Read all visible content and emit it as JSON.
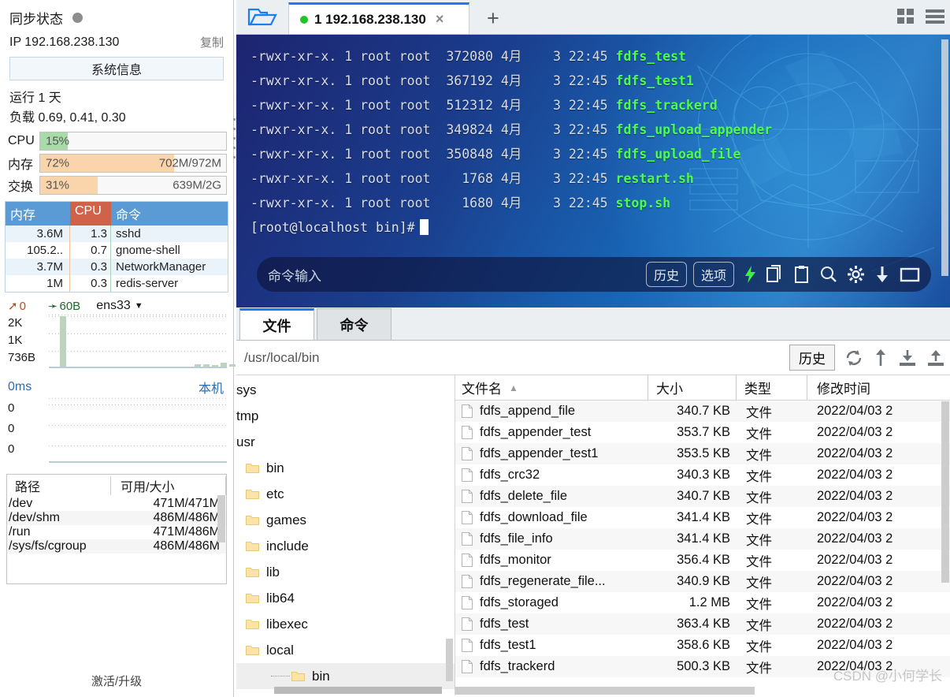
{
  "sidebar": {
    "sync_label": "同步状态",
    "sync_status_color": "#8d8d8d",
    "ip_text": "IP 192.168.238.130",
    "copy_label": "复制",
    "sysinfo_button": "系统信息",
    "uptime": "运行 1 天",
    "loadavg": "负载 0.69, 0.41, 0.30",
    "meters": [
      {
        "label": "CPU",
        "pct_text": "15%",
        "pct": 15,
        "value": "",
        "color": "#a9dba9"
      },
      {
        "label": "内存",
        "pct_text": "72%",
        "pct": 72,
        "value": "702M/972M",
        "color": "#fad4aa"
      },
      {
        "label": "交换",
        "pct_text": "31%",
        "pct": 31,
        "value": "639M/2G",
        "color": "#fad4aa"
      }
    ],
    "proc_headers": {
      "mem": "内存",
      "cpu": "CPU",
      "cmd": "命令"
    },
    "proc_header_bg": "#5b9bd5",
    "proc_cpu_bg": "#d0624a",
    "processes": [
      {
        "mem": "3.6M",
        "cpu": "1.3",
        "cmd": "sshd"
      },
      {
        "mem": "105.2..",
        "cpu": "0.7",
        "cmd": "gnome-shell"
      },
      {
        "mem": "3.7M",
        "cpu": "0.3",
        "cmd": "NetworkManager"
      },
      {
        "mem": "1M",
        "cpu": "0.3",
        "cmd": "redis-server"
      }
    ],
    "net": {
      "upload": "0",
      "download": "60B",
      "interface": "ens33",
      "y_labels": [
        "2K",
        "1K",
        "736B"
      ]
    },
    "latency": {
      "value": "0ms",
      "host": "本机",
      "y_labels": [
        "0",
        "0",
        "0"
      ]
    },
    "disk_headers": {
      "path": "路径",
      "size": "可用/大小"
    },
    "disks": [
      {
        "path": "/dev",
        "size": "471M/471M"
      },
      {
        "path": "/dev/shm",
        "size": "486M/486M"
      },
      {
        "path": "/run",
        "size": "471M/486M"
      },
      {
        "path": "/sys/fs/cgroup",
        "size": "486M/486M"
      }
    ],
    "activate_label": "激活/升级"
  },
  "terminal": {
    "tab": {
      "title": "1 192.168.238.130",
      "status_color": "#22c22a",
      "close": "×"
    },
    "add_tab": "+",
    "lines": [
      {
        "perm": "-rwxr-xr-x. 1 root root",
        "size": "372080",
        "date": "4月    3 22:45",
        "name": "fdfs_test"
      },
      {
        "perm": "-rwxr-xr-x. 1 root root",
        "size": "367192",
        "date": "4月    3 22:45",
        "name": "fdfs_test1"
      },
      {
        "perm": "-rwxr-xr-x. 1 root root",
        "size": "512312",
        "date": "4月    3 22:45",
        "name": "fdfs_trackerd"
      },
      {
        "perm": "-rwxr-xr-x. 1 root root",
        "size": "349824",
        "date": "4月    3 22:45",
        "name": "fdfs_upload_appender"
      },
      {
        "perm": "-rwxr-xr-x. 1 root root",
        "size": "350848",
        "date": "4月    3 22:45",
        "name": "fdfs_upload_file"
      },
      {
        "perm": "-rwxr-xr-x. 1 root root",
        "size": "1768",
        "date": "4月    3 22:45",
        "name": "restart.sh"
      },
      {
        "perm": "-rwxr-xr-x. 1 root root",
        "size": "1680",
        "date": "4月    3 22:45",
        "name": "stop.sh"
      }
    ],
    "prompt": "[root@localhost bin]#",
    "command_placeholder": "命令输入",
    "history_button": "历史",
    "options_button": "选项"
  },
  "file_panel": {
    "tabs": [
      {
        "label": "文件",
        "active": true
      },
      {
        "label": "命令",
        "active": false
      }
    ],
    "path": "/usr/local/bin",
    "history_button": "历史",
    "tree": [
      {
        "label": "sys",
        "depth": 0,
        "folder": false,
        "selected": false,
        "clipped": true
      },
      {
        "label": "tmp",
        "depth": 0,
        "folder": false,
        "selected": false,
        "clipped": true
      },
      {
        "label": "usr",
        "depth": 0,
        "folder": false,
        "selected": false,
        "clipped": true
      },
      {
        "label": "bin",
        "depth": 1,
        "folder": true,
        "selected": false
      },
      {
        "label": "etc",
        "depth": 1,
        "folder": true,
        "selected": false
      },
      {
        "label": "games",
        "depth": 1,
        "folder": true,
        "selected": false
      },
      {
        "label": "include",
        "depth": 1,
        "folder": true,
        "selected": false
      },
      {
        "label": "lib",
        "depth": 1,
        "folder": true,
        "selected": false
      },
      {
        "label": "lib64",
        "depth": 1,
        "folder": true,
        "selected": false
      },
      {
        "label": "libexec",
        "depth": 1,
        "folder": true,
        "selected": false
      },
      {
        "label": "local",
        "depth": 1,
        "folder": true,
        "selected": false
      },
      {
        "label": "bin",
        "depth": 2,
        "folder": true,
        "selected": true
      }
    ],
    "columns": {
      "name": "文件名",
      "size": "大小",
      "type": "类型",
      "time": "修改时间"
    },
    "sort_indicator": "▲",
    "files": [
      {
        "name": "fdfs_append_file",
        "size": "340.7 KB",
        "type": "文件",
        "time": "2022/04/03 2"
      },
      {
        "name": "fdfs_appender_test",
        "size": "353.7 KB",
        "type": "文件",
        "time": "2022/04/03 2"
      },
      {
        "name": "fdfs_appender_test1",
        "size": "353.5 KB",
        "type": "文件",
        "time": "2022/04/03 2"
      },
      {
        "name": "fdfs_crc32",
        "size": "340.3 KB",
        "type": "文件",
        "time": "2022/04/03 2"
      },
      {
        "name": "fdfs_delete_file",
        "size": "340.7 KB",
        "type": "文件",
        "time": "2022/04/03 2"
      },
      {
        "name": "fdfs_download_file",
        "size": "341.4 KB",
        "type": "文件",
        "time": "2022/04/03 2"
      },
      {
        "name": "fdfs_file_info",
        "size": "341.4 KB",
        "type": "文件",
        "time": "2022/04/03 2"
      },
      {
        "name": "fdfs_monitor",
        "size": "356.4 KB",
        "type": "文件",
        "time": "2022/04/03 2"
      },
      {
        "name": "fdfs_regenerate_file...",
        "size": "340.9 KB",
        "type": "文件",
        "time": "2022/04/03 2"
      },
      {
        "name": "fdfs_storaged",
        "size": "1.2 MB",
        "type": "文件",
        "time": "2022/04/03 2"
      },
      {
        "name": "fdfs_test",
        "size": "363.4 KB",
        "type": "文件",
        "time": "2022/04/03 2"
      },
      {
        "name": "fdfs_test1",
        "size": "358.6 KB",
        "type": "文件",
        "time": "2022/04/03 2"
      },
      {
        "name": "fdfs_trackerd",
        "size": "500.3 KB",
        "type": "文件",
        "time": "2022/04/03 2"
      }
    ],
    "watermark": "CSDN @小何学长"
  }
}
